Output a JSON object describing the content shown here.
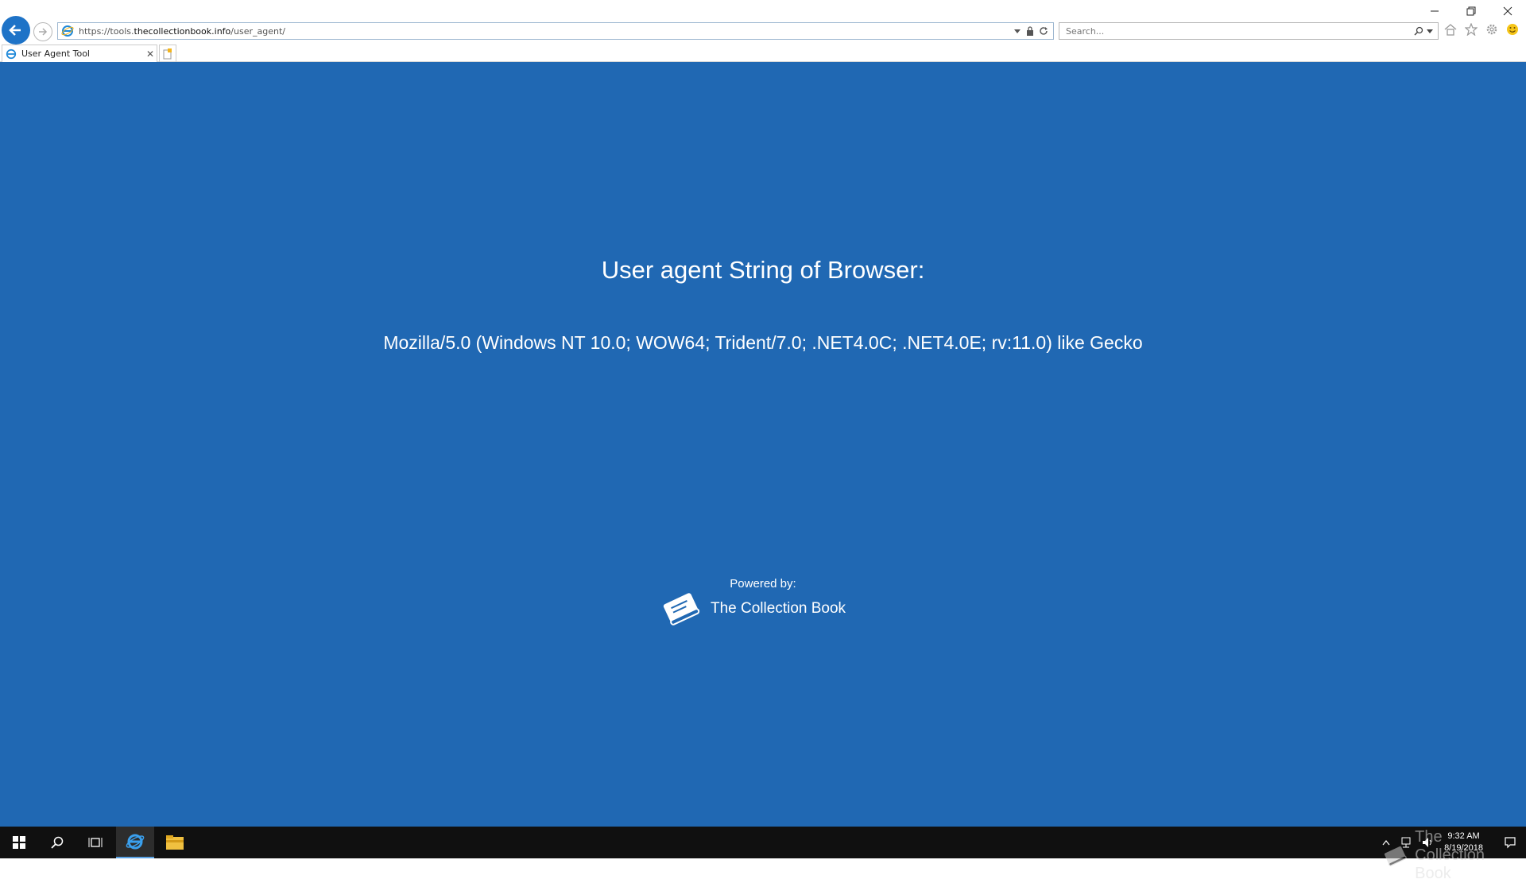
{
  "browser": {
    "url_prefix": "https://tools.",
    "url_host": "thecollectionbook.info",
    "url_path": "/user_agent/",
    "search_placeholder": "Search...",
    "tab_title": "User Agent Tool"
  },
  "page": {
    "heading": "User agent String of Browser:",
    "user_agent": "Mozilla/5.0 (Windows NT 10.0; WOW64; Trident/7.0; .NET4.0C; .NET4.0E; rv:11.0) like Gecko",
    "powered_by": "Powered by:",
    "brand_name": "The Collection Book"
  },
  "taskbar": {
    "time": "9:32 AM",
    "date": "8/19/2018",
    "watermark": "The Collection Book"
  },
  "colors": {
    "page_background": "#2068b3",
    "accent": "#1e73c7",
    "taskbar": "#101010"
  }
}
